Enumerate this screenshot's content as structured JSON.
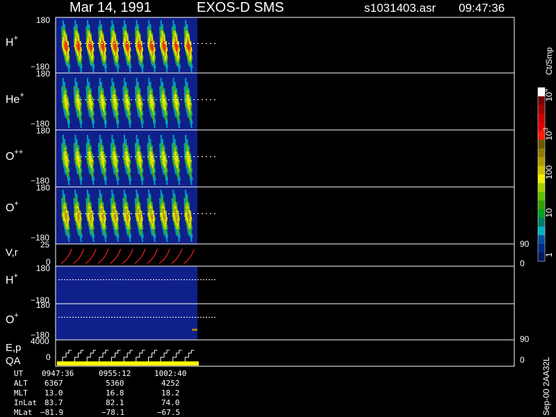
{
  "header": {
    "date": "Mar 14, 1991",
    "instrument": "EXOS-D SMS",
    "file": "s1031403.asr",
    "time": "09:47:36"
  },
  "panels": [
    {
      "label": "H",
      "sup": "+",
      "ytop": "180",
      "ybot": "−180"
    },
    {
      "label": "He",
      "sup": "+",
      "ytop": "180",
      "ybot": "−180"
    },
    {
      "label": "O",
      "sup": "++",
      "ytop": "180",
      "ybot": "−180"
    },
    {
      "label": "O",
      "sup": "+",
      "ytop": "180",
      "ybot": "−180"
    }
  ],
  "vr_panel": {
    "label": "V,r",
    "ytop": "25",
    "ybot": "0",
    "right_top": "90",
    "right_bot": "0"
  },
  "lower_panels": [
    {
      "label": "H",
      "sup": "+",
      "ytop": "180",
      "ybot": "−180"
    },
    {
      "label": "O",
      "sup": "+",
      "ytop": "180",
      "ybot": "−180"
    }
  ],
  "ep_panel": {
    "label": "E,p",
    "label2": "QA",
    "ytop": "4000",
    "ybot": "0",
    "right_top": "90",
    "right_bot": "0"
  },
  "colorbar": {
    "unit": "Ct/Smp",
    "ticks": [
      {
        "base": "10",
        "exp": "4"
      },
      {
        "base": "10",
        "exp": "3"
      },
      {
        "base": "100",
        "exp": ""
      },
      {
        "base": "10",
        "exp": ""
      },
      {
        "base": "1",
        "exp": ""
      }
    ],
    "colors": [
      "#ffffff",
      "#7a0000",
      "#a00000",
      "#c80000",
      "#e00000",
      "#ff1a00",
      "#6b5a00",
      "#8f7a00",
      "#b09a00",
      "#d0c000",
      "#f0f000",
      "#a0d000",
      "#60c000",
      "#30a000",
      "#00a020",
      "#007a6a",
      "#00b0c0",
      "#0050a0",
      "#002a80",
      "#001a60"
    ]
  },
  "footer_table": {
    "row_labels": [
      "UT",
      "ALT",
      "MLT",
      "InLat",
      "MLat"
    ],
    "columns": [
      [
        "0947:36",
        "6367",
        "13.0",
        "83.7",
        "−81.9"
      ],
      [
        "0955:12",
        "5360",
        "16.8",
        "82.1",
        "−78.1"
      ],
      [
        "1002:40",
        "4252",
        "18.2",
        "74.0",
        "−67.5"
      ]
    ]
  },
  "side_note": "Sep-00  2AA32L",
  "colors": {
    "panel_bg": "#10208a",
    "border": "#ffffff",
    "vr_trace": "#ff2020",
    "qa_bar": "#ffff00"
  },
  "chart_data": {
    "type": "heatmap",
    "title": "Mar 14, 1991   EXOS-D SMS",
    "xlabel": "UT",
    "x_ticks": [
      "0947:36",
      "0955:12",
      "1002:40"
    ],
    "series": [
      {
        "name": "H+",
        "ylim": [
          -180,
          180
        ],
        "max_level": "10^4"
      },
      {
        "name": "He+",
        "ylim": [
          -180,
          180
        ],
        "max_level": "10^3"
      },
      {
        "name": "O++",
        "ylim": [
          -180,
          180
        ],
        "max_level": "10^3"
      },
      {
        "name": "O+",
        "ylim": [
          -180,
          180
        ],
        "max_level": "10^3"
      }
    ],
    "colorbar": {
      "label": "Ct/Smp",
      "scale": "log",
      "range": [
        1,
        10000
      ]
    },
    "spin_periods_visible": 11
  }
}
